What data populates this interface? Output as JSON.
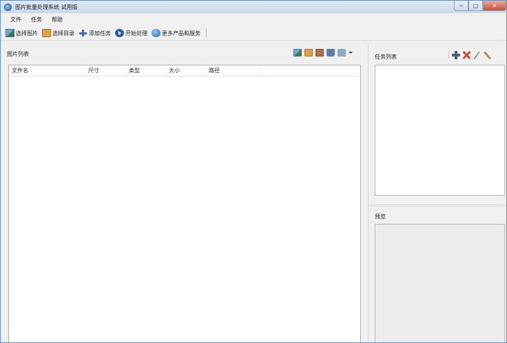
{
  "window": {
    "title": "图片批量处理系统 试用版",
    "controls": {
      "minimize": "─",
      "maximize": "□",
      "close": "✕"
    }
  },
  "menu": [
    {
      "label": "文件"
    },
    {
      "label": "任务"
    },
    {
      "label": "帮助"
    }
  ],
  "toolbar": [
    {
      "label": "选择图片",
      "icon": "picture-icon"
    },
    {
      "label": "选择目录",
      "icon": "folder-icon"
    },
    {
      "label": "添加任务",
      "icon": "add-icon"
    },
    {
      "label": "开始处理",
      "icon": "play-icon"
    },
    {
      "label": "更多产品和服务",
      "icon": "globe-icon"
    }
  ],
  "image_list": {
    "label": "图片列表",
    "columns": [
      "文件名",
      "尺寸",
      "类型",
      "大小",
      "路径"
    ],
    "rows": []
  },
  "task_list": {
    "label": "任务列表"
  },
  "preview": {
    "label": "预览"
  }
}
